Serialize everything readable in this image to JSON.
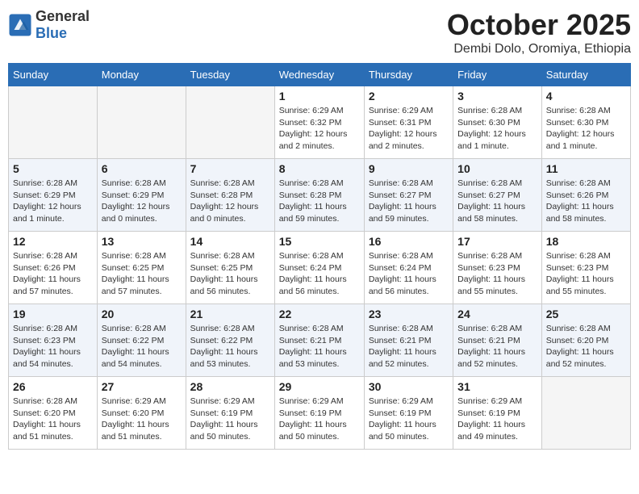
{
  "header": {
    "logo_general": "General",
    "logo_blue": "Blue",
    "month_title": "October 2025",
    "location": "Dembi Dolo, Oromiya, Ethiopia"
  },
  "days_of_week": [
    "Sunday",
    "Monday",
    "Tuesday",
    "Wednesday",
    "Thursday",
    "Friday",
    "Saturday"
  ],
  "weeks": [
    [
      {
        "day": "",
        "info": ""
      },
      {
        "day": "",
        "info": ""
      },
      {
        "day": "",
        "info": ""
      },
      {
        "day": "1",
        "info": "Sunrise: 6:29 AM\nSunset: 6:32 PM\nDaylight: 12 hours and 2 minutes."
      },
      {
        "day": "2",
        "info": "Sunrise: 6:29 AM\nSunset: 6:31 PM\nDaylight: 12 hours and 2 minutes."
      },
      {
        "day": "3",
        "info": "Sunrise: 6:28 AM\nSunset: 6:30 PM\nDaylight: 12 hours and 1 minute."
      },
      {
        "day": "4",
        "info": "Sunrise: 6:28 AM\nSunset: 6:30 PM\nDaylight: 12 hours and 1 minute."
      }
    ],
    [
      {
        "day": "5",
        "info": "Sunrise: 6:28 AM\nSunset: 6:29 PM\nDaylight: 12 hours and 1 minute."
      },
      {
        "day": "6",
        "info": "Sunrise: 6:28 AM\nSunset: 6:29 PM\nDaylight: 12 hours and 0 minutes."
      },
      {
        "day": "7",
        "info": "Sunrise: 6:28 AM\nSunset: 6:28 PM\nDaylight: 12 hours and 0 minutes."
      },
      {
        "day": "8",
        "info": "Sunrise: 6:28 AM\nSunset: 6:28 PM\nDaylight: 11 hours and 59 minutes."
      },
      {
        "day": "9",
        "info": "Sunrise: 6:28 AM\nSunset: 6:27 PM\nDaylight: 11 hours and 59 minutes."
      },
      {
        "day": "10",
        "info": "Sunrise: 6:28 AM\nSunset: 6:27 PM\nDaylight: 11 hours and 58 minutes."
      },
      {
        "day": "11",
        "info": "Sunrise: 6:28 AM\nSunset: 6:26 PM\nDaylight: 11 hours and 58 minutes."
      }
    ],
    [
      {
        "day": "12",
        "info": "Sunrise: 6:28 AM\nSunset: 6:26 PM\nDaylight: 11 hours and 57 minutes."
      },
      {
        "day": "13",
        "info": "Sunrise: 6:28 AM\nSunset: 6:25 PM\nDaylight: 11 hours and 57 minutes."
      },
      {
        "day": "14",
        "info": "Sunrise: 6:28 AM\nSunset: 6:25 PM\nDaylight: 11 hours and 56 minutes."
      },
      {
        "day": "15",
        "info": "Sunrise: 6:28 AM\nSunset: 6:24 PM\nDaylight: 11 hours and 56 minutes."
      },
      {
        "day": "16",
        "info": "Sunrise: 6:28 AM\nSunset: 6:24 PM\nDaylight: 11 hours and 56 minutes."
      },
      {
        "day": "17",
        "info": "Sunrise: 6:28 AM\nSunset: 6:23 PM\nDaylight: 11 hours and 55 minutes."
      },
      {
        "day": "18",
        "info": "Sunrise: 6:28 AM\nSunset: 6:23 PM\nDaylight: 11 hours and 55 minutes."
      }
    ],
    [
      {
        "day": "19",
        "info": "Sunrise: 6:28 AM\nSunset: 6:23 PM\nDaylight: 11 hours and 54 minutes."
      },
      {
        "day": "20",
        "info": "Sunrise: 6:28 AM\nSunset: 6:22 PM\nDaylight: 11 hours and 54 minutes."
      },
      {
        "day": "21",
        "info": "Sunrise: 6:28 AM\nSunset: 6:22 PM\nDaylight: 11 hours and 53 minutes."
      },
      {
        "day": "22",
        "info": "Sunrise: 6:28 AM\nSunset: 6:21 PM\nDaylight: 11 hours and 53 minutes."
      },
      {
        "day": "23",
        "info": "Sunrise: 6:28 AM\nSunset: 6:21 PM\nDaylight: 11 hours and 52 minutes."
      },
      {
        "day": "24",
        "info": "Sunrise: 6:28 AM\nSunset: 6:21 PM\nDaylight: 11 hours and 52 minutes."
      },
      {
        "day": "25",
        "info": "Sunrise: 6:28 AM\nSunset: 6:20 PM\nDaylight: 11 hours and 52 minutes."
      }
    ],
    [
      {
        "day": "26",
        "info": "Sunrise: 6:28 AM\nSunset: 6:20 PM\nDaylight: 11 hours and 51 minutes."
      },
      {
        "day": "27",
        "info": "Sunrise: 6:29 AM\nSunset: 6:20 PM\nDaylight: 11 hours and 51 minutes."
      },
      {
        "day": "28",
        "info": "Sunrise: 6:29 AM\nSunset: 6:19 PM\nDaylight: 11 hours and 50 minutes."
      },
      {
        "day": "29",
        "info": "Sunrise: 6:29 AM\nSunset: 6:19 PM\nDaylight: 11 hours and 50 minutes."
      },
      {
        "day": "30",
        "info": "Sunrise: 6:29 AM\nSunset: 6:19 PM\nDaylight: 11 hours and 50 minutes."
      },
      {
        "day": "31",
        "info": "Sunrise: 6:29 AM\nSunset: 6:19 PM\nDaylight: 11 hours and 49 minutes."
      },
      {
        "day": "",
        "info": ""
      }
    ]
  ]
}
